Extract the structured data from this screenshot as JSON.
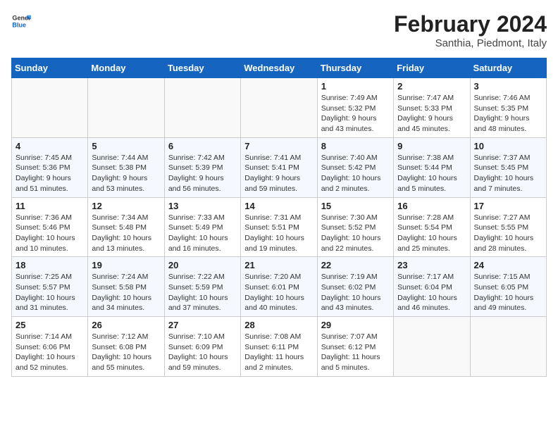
{
  "header": {
    "logo_line1": "General",
    "logo_line2": "Blue",
    "month": "February 2024",
    "location": "Santhia, Piedmont, Italy"
  },
  "days_of_week": [
    "Sunday",
    "Monday",
    "Tuesday",
    "Wednesday",
    "Thursday",
    "Friday",
    "Saturday"
  ],
  "weeks": [
    [
      {
        "day": "",
        "info": ""
      },
      {
        "day": "",
        "info": ""
      },
      {
        "day": "",
        "info": ""
      },
      {
        "day": "",
        "info": ""
      },
      {
        "day": "1",
        "info": "Sunrise: 7:49 AM\nSunset: 5:32 PM\nDaylight: 9 hours\nand 43 minutes."
      },
      {
        "day": "2",
        "info": "Sunrise: 7:47 AM\nSunset: 5:33 PM\nDaylight: 9 hours\nand 45 minutes."
      },
      {
        "day": "3",
        "info": "Sunrise: 7:46 AM\nSunset: 5:35 PM\nDaylight: 9 hours\nand 48 minutes."
      }
    ],
    [
      {
        "day": "4",
        "info": "Sunrise: 7:45 AM\nSunset: 5:36 PM\nDaylight: 9 hours\nand 51 minutes."
      },
      {
        "day": "5",
        "info": "Sunrise: 7:44 AM\nSunset: 5:38 PM\nDaylight: 9 hours\nand 53 minutes."
      },
      {
        "day": "6",
        "info": "Sunrise: 7:42 AM\nSunset: 5:39 PM\nDaylight: 9 hours\nand 56 minutes."
      },
      {
        "day": "7",
        "info": "Sunrise: 7:41 AM\nSunset: 5:41 PM\nDaylight: 9 hours\nand 59 minutes."
      },
      {
        "day": "8",
        "info": "Sunrise: 7:40 AM\nSunset: 5:42 PM\nDaylight: 10 hours\nand 2 minutes."
      },
      {
        "day": "9",
        "info": "Sunrise: 7:38 AM\nSunset: 5:44 PM\nDaylight: 10 hours\nand 5 minutes."
      },
      {
        "day": "10",
        "info": "Sunrise: 7:37 AM\nSunset: 5:45 PM\nDaylight: 10 hours\nand 7 minutes."
      }
    ],
    [
      {
        "day": "11",
        "info": "Sunrise: 7:36 AM\nSunset: 5:46 PM\nDaylight: 10 hours\nand 10 minutes."
      },
      {
        "day": "12",
        "info": "Sunrise: 7:34 AM\nSunset: 5:48 PM\nDaylight: 10 hours\nand 13 minutes."
      },
      {
        "day": "13",
        "info": "Sunrise: 7:33 AM\nSunset: 5:49 PM\nDaylight: 10 hours\nand 16 minutes."
      },
      {
        "day": "14",
        "info": "Sunrise: 7:31 AM\nSunset: 5:51 PM\nDaylight: 10 hours\nand 19 minutes."
      },
      {
        "day": "15",
        "info": "Sunrise: 7:30 AM\nSunset: 5:52 PM\nDaylight: 10 hours\nand 22 minutes."
      },
      {
        "day": "16",
        "info": "Sunrise: 7:28 AM\nSunset: 5:54 PM\nDaylight: 10 hours\nand 25 minutes."
      },
      {
        "day": "17",
        "info": "Sunrise: 7:27 AM\nSunset: 5:55 PM\nDaylight: 10 hours\nand 28 minutes."
      }
    ],
    [
      {
        "day": "18",
        "info": "Sunrise: 7:25 AM\nSunset: 5:57 PM\nDaylight: 10 hours\nand 31 minutes."
      },
      {
        "day": "19",
        "info": "Sunrise: 7:24 AM\nSunset: 5:58 PM\nDaylight: 10 hours\nand 34 minutes."
      },
      {
        "day": "20",
        "info": "Sunrise: 7:22 AM\nSunset: 5:59 PM\nDaylight: 10 hours\nand 37 minutes."
      },
      {
        "day": "21",
        "info": "Sunrise: 7:20 AM\nSunset: 6:01 PM\nDaylight: 10 hours\nand 40 minutes."
      },
      {
        "day": "22",
        "info": "Sunrise: 7:19 AM\nSunset: 6:02 PM\nDaylight: 10 hours\nand 43 minutes."
      },
      {
        "day": "23",
        "info": "Sunrise: 7:17 AM\nSunset: 6:04 PM\nDaylight: 10 hours\nand 46 minutes."
      },
      {
        "day": "24",
        "info": "Sunrise: 7:15 AM\nSunset: 6:05 PM\nDaylight: 10 hours\nand 49 minutes."
      }
    ],
    [
      {
        "day": "25",
        "info": "Sunrise: 7:14 AM\nSunset: 6:06 PM\nDaylight: 10 hours\nand 52 minutes."
      },
      {
        "day": "26",
        "info": "Sunrise: 7:12 AM\nSunset: 6:08 PM\nDaylight: 10 hours\nand 55 minutes."
      },
      {
        "day": "27",
        "info": "Sunrise: 7:10 AM\nSunset: 6:09 PM\nDaylight: 10 hours\nand 59 minutes."
      },
      {
        "day": "28",
        "info": "Sunrise: 7:08 AM\nSunset: 6:11 PM\nDaylight: 11 hours\nand 2 minutes."
      },
      {
        "day": "29",
        "info": "Sunrise: 7:07 AM\nSunset: 6:12 PM\nDaylight: 11 hours\nand 5 minutes."
      },
      {
        "day": "",
        "info": ""
      },
      {
        "day": "",
        "info": ""
      }
    ]
  ]
}
